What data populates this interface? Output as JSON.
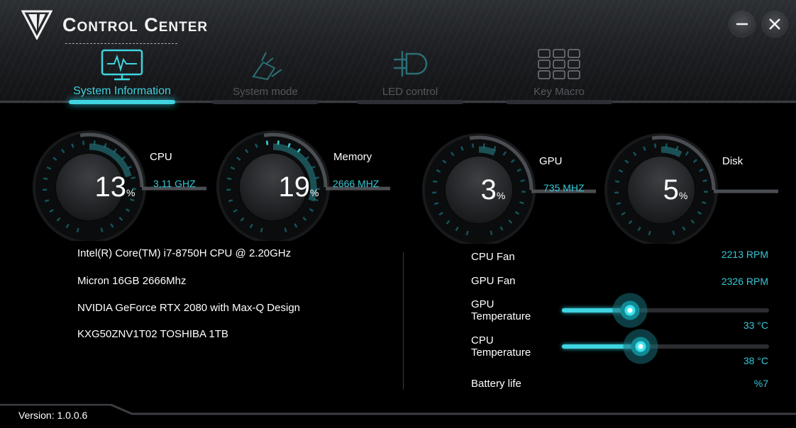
{
  "app": {
    "title": "Control Center"
  },
  "window": {
    "minimize_icon": "minimize-icon",
    "close_icon": "close-icon"
  },
  "tabs": [
    {
      "label": "System Information",
      "icon": "monitor-pulse-icon",
      "active": true
    },
    {
      "label": "System mode",
      "icon": "system-mode-icon",
      "active": false
    },
    {
      "label": "LED control",
      "icon": "led-icon",
      "active": false
    },
    {
      "label": "Key Macro",
      "icon": "keypad-icon",
      "active": false
    }
  ],
  "gauges": [
    {
      "name": "CPU",
      "value": "13",
      "unit": "%",
      "sub": "3,11 GHZ",
      "percent": 13
    },
    {
      "name": "Memory",
      "value": "19",
      "unit": "%",
      "sub": "2666 MHZ",
      "percent": 19
    },
    {
      "name": "GPU",
      "value": "3",
      "unit": "%",
      "sub": "735 MHZ",
      "percent": 3
    },
    {
      "name": "Disk",
      "value": "5",
      "unit": "%",
      "sub": "",
      "percent": 5
    }
  ],
  "specs": [
    "Intel(R) Core(TM) i7-8750H CPU @ 2.20GHz",
    "Micron 16GB 2666Mhz",
    "NVIDIA GeForce RTX 2080 with Max-Q Design",
    "KXG50ZNV1T02 TOSHIBA 1TB"
  ],
  "stats": {
    "cpu_fan": {
      "label": "CPU Fan",
      "value": "2213 RPM"
    },
    "gpu_fan": {
      "label": "GPU Fan",
      "value": "2326 RPM"
    },
    "gpu_temp": {
      "label_line1": "GPU",
      "label_line2": "Temperature",
      "value": "33 °C",
      "level_percent": 33
    },
    "cpu_temp": {
      "label_line1": "CPU",
      "label_line2": "Temperature",
      "value": "38 °C",
      "level_percent": 38
    },
    "battery": {
      "label": "Battery life",
      "value": "%7"
    }
  },
  "footer": {
    "version": "Version: 1.0.0.6"
  },
  "colors": {
    "accent": "#3fd4e0",
    "background": "#000000",
    "header": "#1b1d20"
  }
}
